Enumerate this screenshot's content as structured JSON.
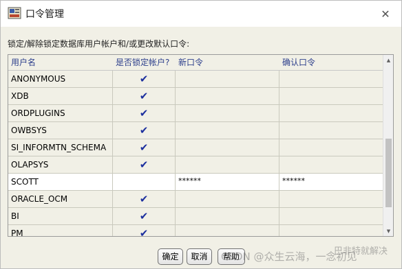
{
  "window": {
    "title": "口令管理",
    "close_glyph": "✕"
  },
  "instruction": "锁定/解除锁定数据库用户帐户和/或更改默认口令:",
  "table": {
    "headers": [
      "用户名",
      "是否锁定帐户?",
      "新口令",
      "确认口令"
    ],
    "rows": [
      {
        "user": "ANONYMOUS",
        "locked": "✔",
        "new_pw": "",
        "confirm_pw": ""
      },
      {
        "user": "XDB",
        "locked": "✔",
        "new_pw": "",
        "confirm_pw": ""
      },
      {
        "user": "ORDPLUGINS",
        "locked": "✔",
        "new_pw": "",
        "confirm_pw": ""
      },
      {
        "user": "OWBSYS",
        "locked": "✔",
        "new_pw": "",
        "confirm_pw": ""
      },
      {
        "user": "SI_INFORMTN_SCHEMA",
        "locked": "✔",
        "new_pw": "",
        "confirm_pw": ""
      },
      {
        "user": "OLAPSYS",
        "locked": "✔",
        "new_pw": "",
        "confirm_pw": ""
      },
      {
        "user": "SCOTT",
        "locked": "",
        "new_pw": "******",
        "confirm_pw": "******"
      },
      {
        "user": "ORACLE_OCM",
        "locked": "✔",
        "new_pw": "",
        "confirm_pw": ""
      },
      {
        "user": "BI",
        "locked": "✔",
        "new_pw": "",
        "confirm_pw": ""
      },
      {
        "user": "PM",
        "locked": "✔",
        "new_pw": "",
        "confirm_pw": ""
      }
    ]
  },
  "buttons": {
    "ok": "确定",
    "cancel": "取消",
    "help": "帮助"
  },
  "watermark": "CSDN @众生云海，一念初见",
  "watermark2": "巴非特就解决",
  "icons": {
    "app": "oracle-app-icon",
    "close": "close-icon",
    "check": "checkmark-icon"
  },
  "colors": {
    "header_text": "#2d3f8c",
    "check": "#1c2f9e",
    "window_bg": "#f1f0e6"
  }
}
